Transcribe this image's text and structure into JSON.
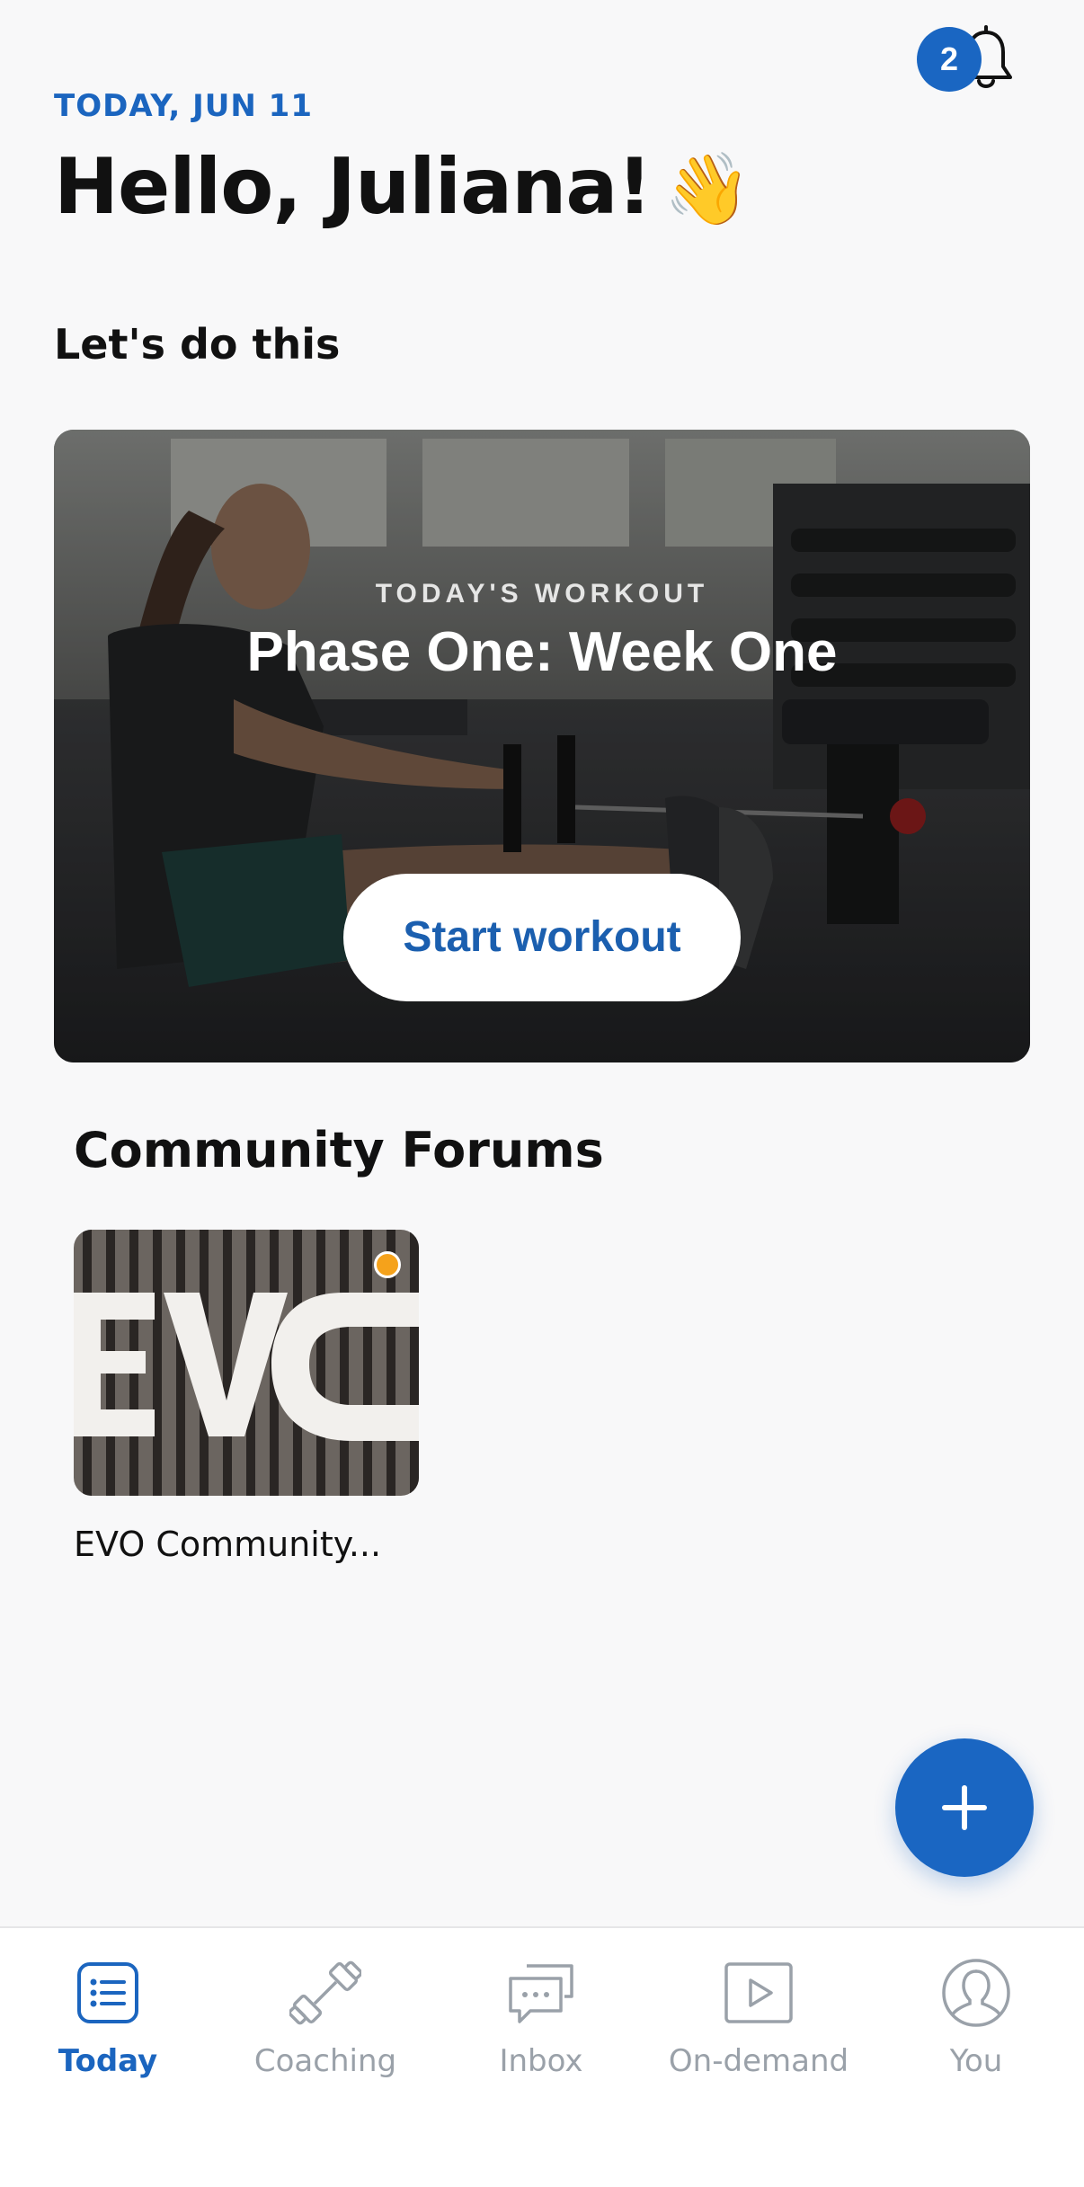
{
  "header": {
    "notification_count": "2",
    "date_label": "TODAY, JUN 11",
    "greeting": "Hello, Juliana!",
    "greeting_emoji": "👋"
  },
  "sections": {
    "lets_do_this": "Let's do this",
    "community_forums": "Community Forums"
  },
  "workout_card": {
    "eyebrow": "TODAY'S WORKOUT",
    "title": "Phase One: Week One",
    "button_label": "Start workout"
  },
  "forums": [
    {
      "name": "EVO Community...",
      "has_unread": true
    }
  ],
  "fab": {
    "icon": "plus-icon"
  },
  "bottom_nav": {
    "items": [
      {
        "label": "Today",
        "icon": "list-icon",
        "active": true
      },
      {
        "label": "Coaching",
        "icon": "dumbbell-icon",
        "active": false
      },
      {
        "label": "Inbox",
        "icon": "chat-icon",
        "active": false
      },
      {
        "label": "On-demand",
        "icon": "play-icon",
        "active": false
      },
      {
        "label": "You",
        "icon": "user-icon",
        "active": false
      }
    ]
  },
  "colors": {
    "accent": "#1a66c2",
    "unread_dot": "#f5a21b",
    "inactive_nav": "#9aa1a9"
  }
}
